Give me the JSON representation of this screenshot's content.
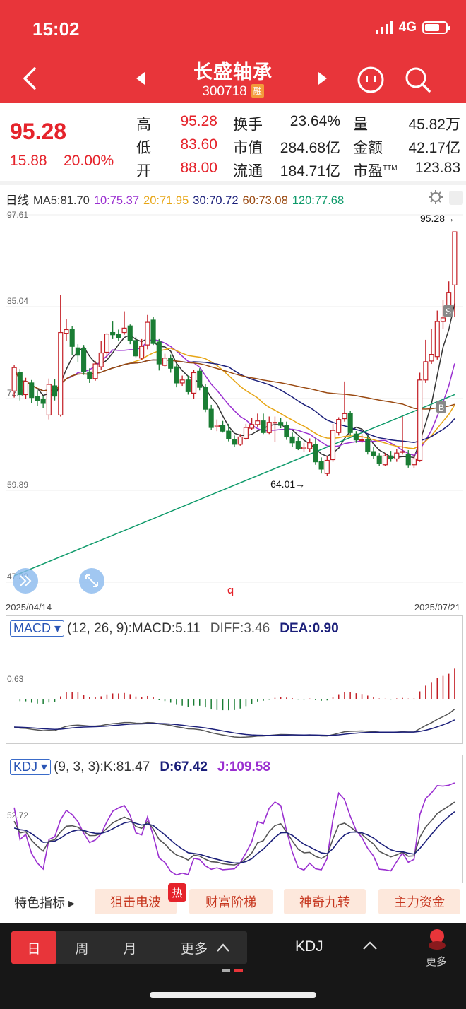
{
  "status_bar": {
    "time": "15:02",
    "network": "4G"
  },
  "header": {
    "name": "长盛轴承",
    "code": "300718",
    "margin_badge": "融"
  },
  "quote": {
    "price": "95.28",
    "change": "15.88",
    "change_pct": "20.00%",
    "rows": [
      [
        {
          "k": "高",
          "v": "95.28",
          "red": true
        },
        {
          "k": "换手",
          "v": "23.64%"
        },
        {
          "k": "量",
          "v": "45.82万"
        }
      ],
      [
        {
          "k": "低",
          "v": "83.60",
          "red": true
        },
        {
          "k": "市值",
          "v": "284.68亿"
        },
        {
          "k": "金额",
          "v": "42.17亿"
        }
      ],
      [
        {
          "k": "开",
          "v": "88.00",
          "red": true
        },
        {
          "k": "流通",
          "v": "184.71亿"
        },
        {
          "k": "市盈",
          "sup": "TTM",
          "v": "123.83"
        }
      ]
    ]
  },
  "ma_legend": {
    "period": "日线",
    "items": [
      {
        "label": "MA5:81.70",
        "color": "#333333"
      },
      {
        "label": "10:75.37",
        "color": "#9a2fd0"
      },
      {
        "label": "20:71.95",
        "color": "#e7a514"
      },
      {
        "label": "30:70.72",
        "color": "#1b1f7a"
      },
      {
        "label": "60:73.08",
        "color": "#9a4a12"
      },
      {
        "label": "120:77.68",
        "color": "#0e9a6a"
      }
    ]
  },
  "kline": {
    "price_labels": [
      "97.61",
      "85.04",
      "72.47",
      "59.89",
      "47.32"
    ],
    "high_label": "95.28→",
    "low_label": "64.01→",
    "start_date": "2025/04/14",
    "end_date": "2025/07/21",
    "marker_b": "B",
    "marker_s": "S",
    "cursor_letter": "q",
    "candles": [
      [
        73.5,
        76.7,
        77.1,
        72.6
      ],
      [
        76.0,
        73.0,
        76.5,
        72.2
      ],
      [
        73.0,
        74.8,
        75.3,
        72.4
      ],
      [
        74.6,
        72.6,
        75.0,
        71.8
      ],
      [
        72.7,
        72.2,
        73.6,
        71.4
      ],
      [
        72.4,
        71.8,
        72.8,
        71.2
      ],
      [
        70.2,
        74.4,
        75.2,
        69.6
      ],
      [
        74.2,
        72.8,
        75.1,
        72.2
      ],
      [
        70.2,
        81.5,
        86.6,
        70.0
      ],
      [
        81.4,
        81.9,
        83.3,
        80.3
      ],
      [
        81.9,
        79.6,
        82.4,
        78.4
      ],
      [
        79.4,
        78.4,
        79.9,
        77.4
      ],
      [
        79.3,
        76.2,
        79.8,
        75.7
      ],
      [
        76.1,
        75.2,
        76.6,
        74.6
      ],
      [
        75.2,
        77.2,
        77.6,
        74.9
      ],
      [
        76.8,
        78.7,
        80.3,
        76.4
      ],
      [
        78.8,
        81.3,
        81.4,
        78.0
      ],
      [
        81.5,
        81.2,
        83.0,
        80.6
      ],
      [
        81.3,
        80.8,
        81.9,
        80.3
      ],
      [
        81.5,
        82.1,
        84.4,
        81.2
      ],
      [
        82.4,
        80.4,
        82.6,
        79.9
      ],
      [
        80.4,
        78.3,
        80.9,
        78.1
      ],
      [
        78.0,
        79.6,
        80.6,
        77.8
      ],
      [
        79.8,
        82.9,
        83.9,
        79.2
      ],
      [
        83.2,
        80.0,
        83.6,
        79.8
      ],
      [
        80.2,
        77.2,
        80.6,
        76.3
      ],
      [
        77.0,
        78.0,
        78.6,
        76.8
      ],
      [
        78.0,
        76.6,
        78.5,
        76.0
      ],
      [
        76.8,
        74.6,
        77.2,
        74.0
      ],
      [
        74.6,
        75.0,
        75.6,
        74.2
      ],
      [
        75.0,
        73.4,
        75.6,
        73.0
      ],
      [
        73.2,
        76.0,
        76.4,
        72.4
      ],
      [
        76.2,
        74.0,
        76.6,
        73.6
      ],
      [
        74.0,
        71.0,
        74.4,
        70.6
      ],
      [
        71.0,
        68.5,
        71.6,
        68.2
      ],
      [
        68.6,
        68.8,
        69.6,
        68.0
      ],
      [
        68.8,
        68.0,
        69.4,
        67.8
      ],
      [
        68.0,
        67.0,
        69.0,
        66.6
      ],
      [
        66.8,
        66.2,
        67.4,
        65.8
      ],
      [
        66.2,
        67.2,
        67.6,
        66.0
      ],
      [
        67.0,
        68.5,
        69.0,
        66.8
      ],
      [
        68.4,
        68.9,
        69.8,
        68.2
      ],
      [
        68.9,
        69.4,
        70.4,
        68.6
      ],
      [
        69.4,
        67.8,
        70.4,
        67.6
      ],
      [
        67.8,
        69.2,
        70.0,
        67.6
      ],
      [
        69.2,
        69.2,
        70.0,
        66.5
      ],
      [
        69.2,
        68.8,
        69.8,
        68.4
      ],
      [
        68.8,
        67.2,
        69.3,
        66.8
      ],
      [
        67.2,
        66.4,
        67.8,
        65.8
      ],
      [
        66.6,
        65.6,
        67.2,
        65.4
      ],
      [
        65.6,
        65.8,
        66.4,
        65.2
      ],
      [
        65.6,
        66.4,
        67.0,
        65.2
      ],
      [
        66.2,
        63.8,
        67.0,
        63.4
      ],
      [
        63.8,
        62.8,
        64.4,
        62.2
      ],
      [
        62.2,
        64.0,
        64.6,
        61.9
      ],
      [
        64.1,
        68.1,
        69.0,
        63.8
      ],
      [
        67.8,
        69.6,
        69.9,
        67.4
      ],
      [
        69.7,
        70.4,
        74.8,
        69.3
      ],
      [
        70.4,
        67.8,
        70.8,
        67.4
      ],
      [
        67.6,
        66.8,
        68.0,
        66.4
      ],
      [
        66.8,
        66.8,
        67.6,
        66.4
      ],
      [
        66.8,
        65.2,
        67.4,
        64.8
      ],
      [
        65.2,
        64.6,
        65.8,
        64.2
      ],
      [
        64.6,
        63.6,
        65.0,
        63.2
      ],
      [
        63.4,
        64.6,
        65.0,
        63.2
      ],
      [
        64.6,
        64.2,
        65.3,
        63.8
      ],
      [
        64.2,
        65.0,
        65.6,
        63.8
      ],
      [
        65.2,
        65.2,
        70.0,
        64.8
      ],
      [
        64.8,
        63.4,
        65.4,
        63.0
      ],
      [
        63.4,
        64.2,
        64.8,
        62.9
      ],
      [
        64.0,
        75.0,
        76.0,
        63.8
      ],
      [
        75.0,
        77.5,
        80.5,
        74.6
      ],
      [
        77.6,
        78.5,
        82.0,
        77.2
      ],
      [
        78.2,
        83.0,
        84.5,
        77.8
      ],
      [
        83.0,
        83.5,
        86.0,
        82.0
      ],
      [
        84.0,
        87.0,
        88.5,
        83.6
      ],
      [
        88.0,
        95.28,
        95.28,
        83.6
      ]
    ]
  },
  "macd": {
    "selector": "MACD",
    "params": "(12, 26, 9):MACD:5.11",
    "diff": "DIFF:3.46",
    "dea": "DEA:0.90",
    "axis_label": "0.63"
  },
  "kdj": {
    "selector": "KDJ",
    "params": "(9, 3, 3):K:81.47",
    "d": "D:67.42",
    "j": "J:109.58",
    "axis_label": "52.72"
  },
  "feature_tabs": {
    "label": "特色指标",
    "items": [
      "狙击电波",
      "财富阶梯",
      "神奇九转",
      "主力资金"
    ],
    "hot_badge": "热"
  },
  "footer": {
    "periods": [
      "日",
      "周",
      "月",
      "更多"
    ],
    "indicator": "KDJ",
    "more": "更多"
  },
  "colors": {
    "up": "#c31e25",
    "down": "#1a7d34",
    "header": "#e8353a"
  }
}
